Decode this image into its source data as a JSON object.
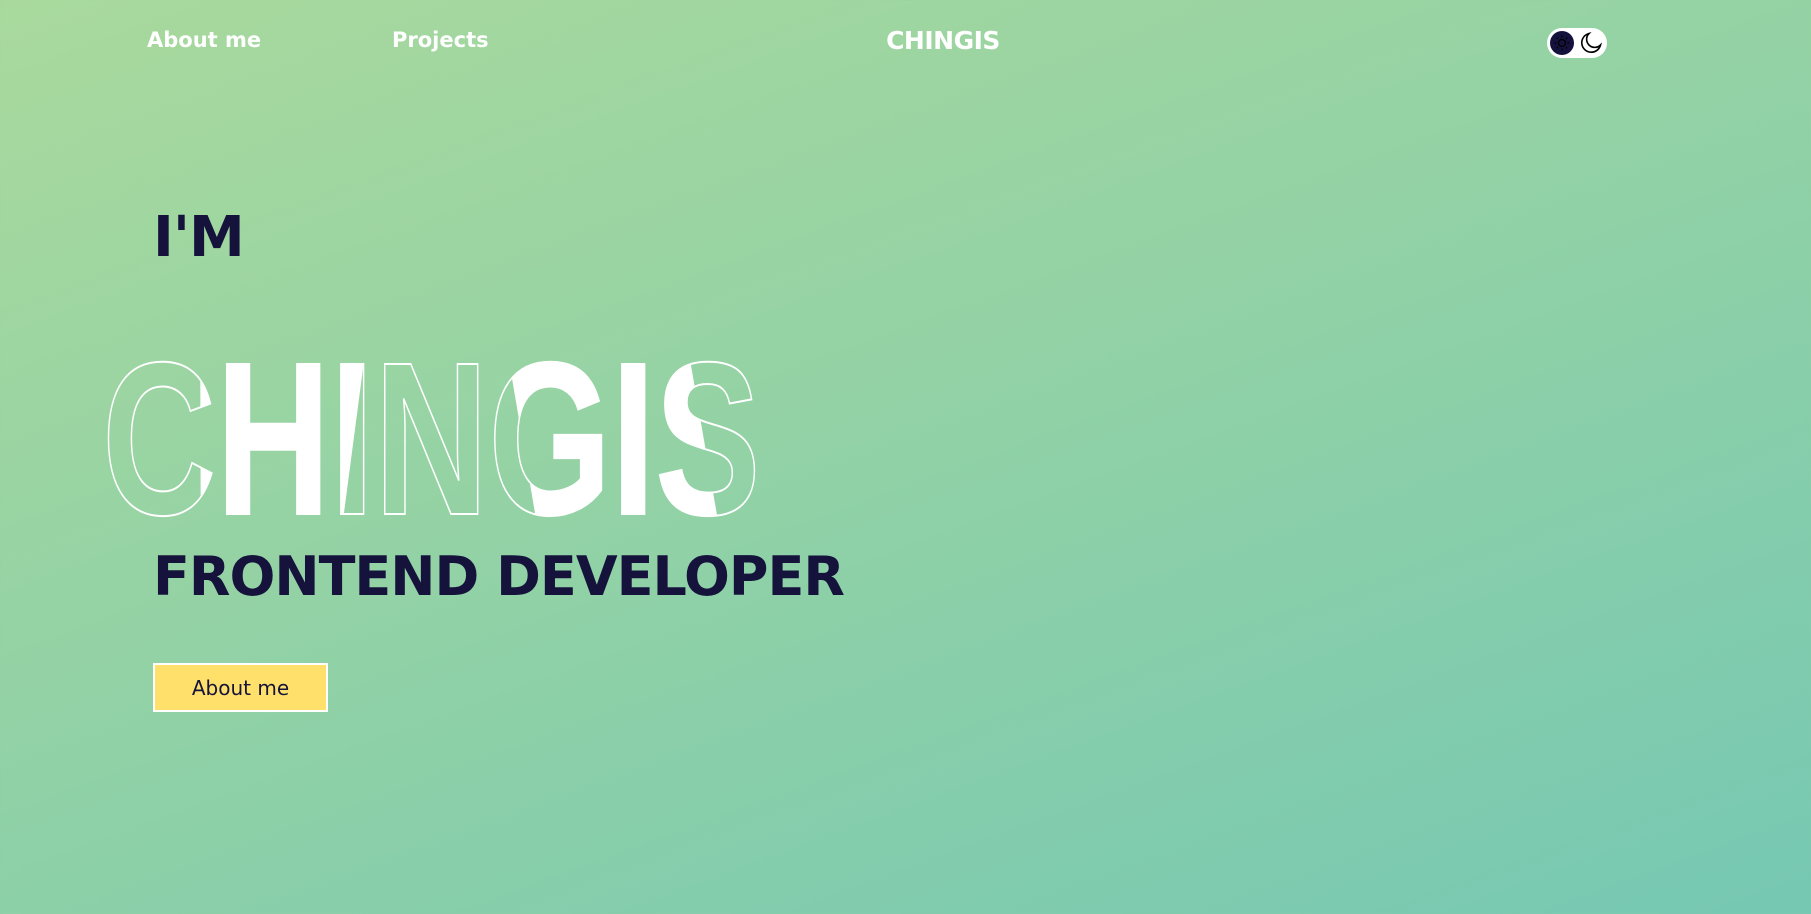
{
  "nav": {
    "links": [
      {
        "label": "About me"
      },
      {
        "label": "Projects"
      }
    ],
    "brand": "CHINGIS",
    "theme_toggle": {
      "icons": [
        "sun-icon",
        "moon-icon"
      ],
      "active": "light"
    }
  },
  "hero": {
    "greeting": "I'M",
    "name": "CHINGIS",
    "role": "FRONTEND DEVELOPER",
    "cta_label": "About me"
  },
  "colors": {
    "text_dark": "#15133c",
    "button": "#ffe06a",
    "bg_start": "#a9d99d",
    "bg_end": "#76c8b3"
  }
}
